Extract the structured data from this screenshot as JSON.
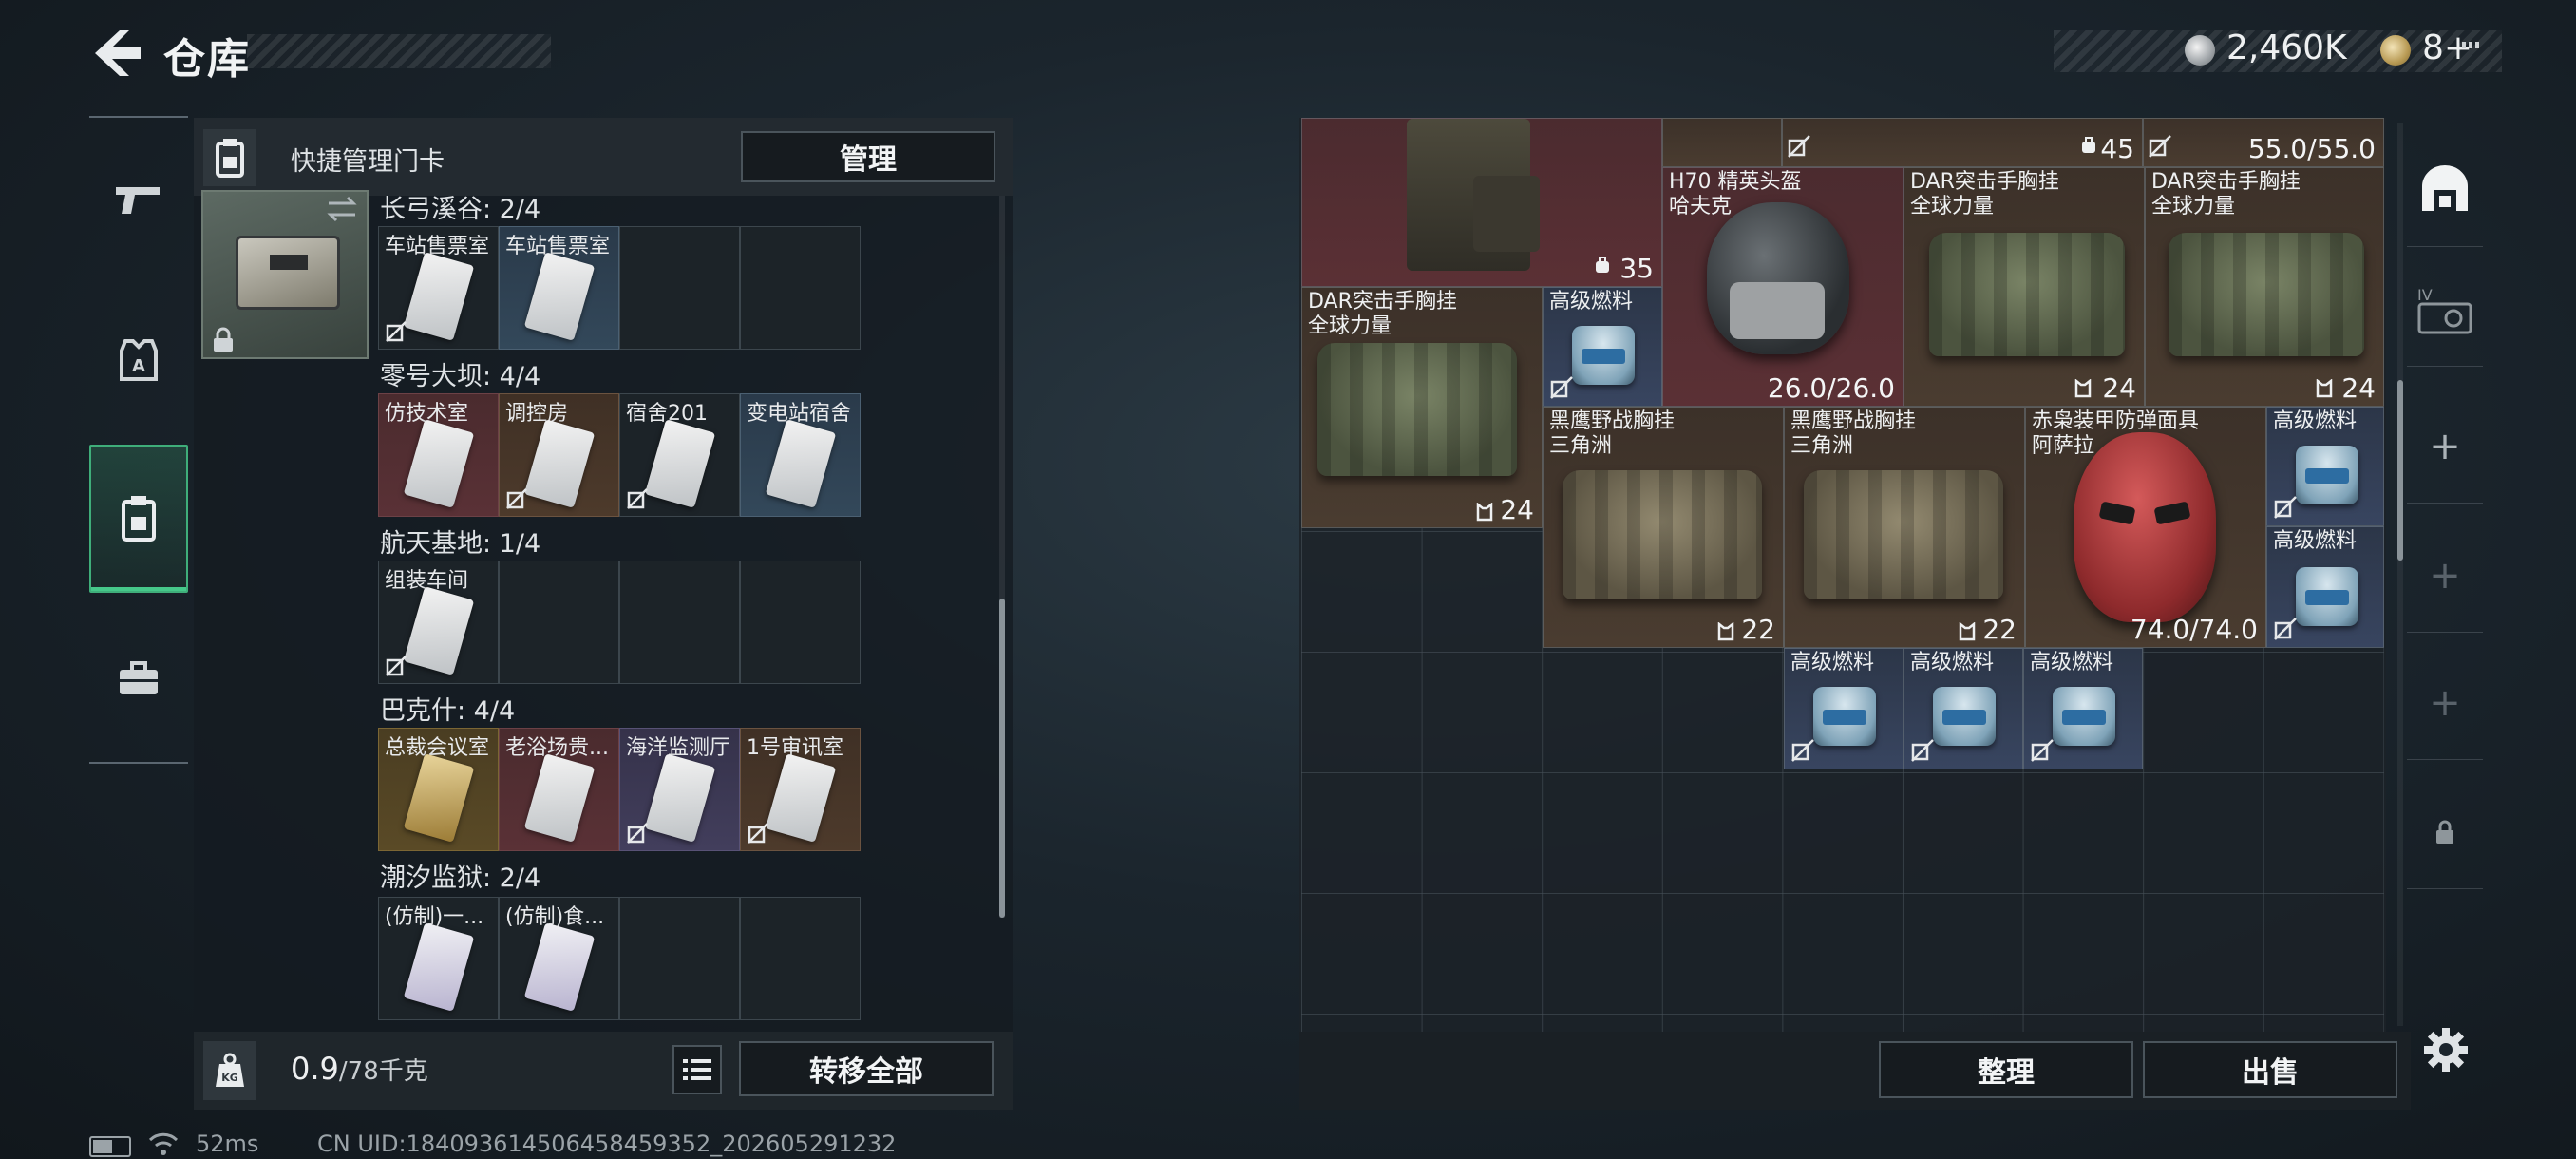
{
  "header": {
    "title": "仓库",
    "currency": [
      {
        "icon": "silver-coin-icon",
        "value": "2,460K"
      },
      {
        "icon": "gold-coin-icon",
        "value": "8+"
      }
    ]
  },
  "left_tabs": [
    {
      "icon": "gun-icon",
      "active": false
    },
    {
      "icon": "armor-icon",
      "active": false
    },
    {
      "icon": "keycard-icon",
      "active": true
    },
    {
      "icon": "briefcase-icon",
      "active": false
    }
  ],
  "card_panel": {
    "header_label": "快捷管理门卡",
    "manage_label": "管理",
    "groups": [
      {
        "title": "长弓溪谷: 2/4",
        "cards": [
          {
            "name": "车站售票室",
            "color": "gray"
          },
          {
            "name": "车站售票室",
            "color": "blue"
          },
          {
            "name": "",
            "color": "empty"
          },
          {
            "name": "",
            "color": "empty"
          }
        ]
      },
      {
        "title": "零号大坝: 4/4",
        "cards": [
          {
            "name": "仿技术室",
            "color": "red"
          },
          {
            "name": "调控房",
            "color": "brown"
          },
          {
            "name": "宿舍201",
            "color": "gray"
          },
          {
            "name": "变电站宿舍",
            "color": "blue"
          }
        ]
      },
      {
        "title": "航天基地: 1/4",
        "cards": [
          {
            "name": "组装车间",
            "color": "gray"
          },
          {
            "name": "",
            "color": "empty"
          },
          {
            "name": "",
            "color": "empty"
          },
          {
            "name": "",
            "color": "empty"
          }
        ]
      },
      {
        "title": "巴克什: 4/4",
        "cards": [
          {
            "name": "总裁会议室",
            "color": "gold"
          },
          {
            "name": "老浴场贵...",
            "color": "red"
          },
          {
            "name": "海洋监测厅",
            "color": "purple"
          },
          {
            "name": "1号审讯室",
            "color": "brown"
          }
        ]
      },
      {
        "title": "潮汐监狱: 2/4",
        "cards": [
          {
            "name": "(仿制)一...",
            "color": "gray"
          },
          {
            "name": "(仿制)食...",
            "color": "gray"
          },
          {
            "name": "",
            "color": "empty"
          },
          {
            "name": "",
            "color": "empty"
          }
        ]
      }
    ],
    "weight_value": "0.9",
    "weight_unit": "/78千克",
    "transfer_all_label": "转移全部"
  },
  "status_bar": {
    "ping": "52ms",
    "uid": "CN UID:1840936145064584593​52_202605291232"
  },
  "stash": {
    "items": [
      {
        "name": "",
        "value": "35",
        "icon": "backpack-icon"
      },
      {
        "name": "",
        "value": "45",
        "icon": "backpack-icon"
      },
      {
        "name": "",
        "value": "55.0/55.0",
        "icon": "armor-icon"
      },
      {
        "name": "H70 精英头盔\n哈夫克",
        "value": "26.0/26.0",
        "icon": "helmet-icon"
      },
      {
        "name": "DAR突击手胸挂\n全球力量",
        "value": "24",
        "icon": "chest-rig-icon"
      },
      {
        "name": "DAR突击手胸挂\n全球力量",
        "value": "24",
        "icon": "chest-rig-icon"
      },
      {
        "name": "DAR突击手胸挂\n全球力量",
        "value": "24",
        "icon": "chest-rig-icon"
      },
      {
        "name": "高级燃料",
        "value": "",
        "icon": "fuel-icon"
      },
      {
        "name": "黑鹰野战胸挂\n三角洲",
        "value": "22",
        "icon": "chest-rig-icon"
      },
      {
        "name": "黑鹰野战胸挂\n三角洲",
        "value": "22",
        "icon": "chest-rig-icon"
      },
      {
        "name": "赤枭装甲防弹面具\n阿萨拉",
        "value": "74.0/74.0",
        "icon": "helmet-icon"
      },
      {
        "name": "高级燃料",
        "value": "",
        "icon": "fuel-icon"
      },
      {
        "name": "高级燃料",
        "value": "",
        "icon": "fuel-icon"
      },
      {
        "name": "高级燃料",
        "value": "",
        "icon": "fuel-icon"
      },
      {
        "name": "高级燃料",
        "value": "",
        "icon": "fuel-icon"
      },
      {
        "name": "高级燃料",
        "value": "",
        "icon": "fuel-icon"
      }
    ],
    "sort_label": "整理",
    "sell_label": "出售"
  },
  "right_rail": [
    {
      "icon": "stash-icon",
      "label": ""
    },
    {
      "icon": "safebox-icon",
      "label": "IV"
    },
    {
      "icon": "plus-icon",
      "label": "+"
    },
    {
      "icon": "plus-icon",
      "label": "+"
    },
    {
      "icon": "plus-icon",
      "label": "+"
    },
    {
      "icon": "lock-icon",
      "label": ""
    }
  ]
}
